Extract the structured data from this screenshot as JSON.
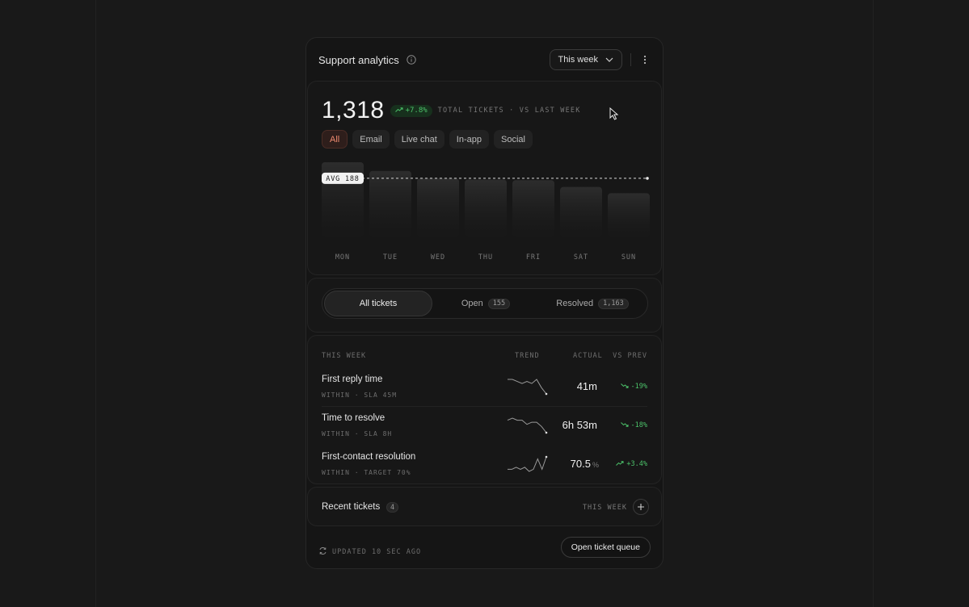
{
  "header": {
    "title": "Support analytics",
    "info_icon": "info-circle-icon",
    "range_select": {
      "value": "This week",
      "icon": "chevron-down-icon"
    },
    "more_icon": "more-vertical-icon"
  },
  "summary": {
    "total": "1,318",
    "delta": "+7.8%",
    "delta_icon": "trend-up-icon",
    "caption": "TOTAL TICKETS · VS LAST WEEK",
    "accent_color": "#ee8a70",
    "positive_color": "#4cc26a"
  },
  "channel_filters": [
    {
      "label": "All",
      "active": true
    },
    {
      "label": "Email",
      "active": false
    },
    {
      "label": "Live chat",
      "active": false
    },
    {
      "label": "In-app",
      "active": false
    },
    {
      "label": "Social",
      "active": false
    }
  ],
  "chart_data": {
    "type": "bar",
    "categories": [
      "MON",
      "TUE",
      "WED",
      "THU",
      "FRI",
      "SAT",
      "SUN"
    ],
    "values": [
      240,
      212,
      188,
      184,
      182,
      160,
      140
    ],
    "reference_line": {
      "label": "AVG 188",
      "value": 188
    },
    "ylim": [
      0,
      240
    ],
    "grid": false,
    "legend": "none"
  },
  "status_tabs": [
    {
      "label": "All tickets",
      "count": null,
      "active": true
    },
    {
      "label": "Open",
      "count": "155",
      "active": false
    },
    {
      "label": "Resolved",
      "count": "1,163",
      "active": false
    }
  ],
  "metrics": {
    "columns": {
      "name": "THIS WEEK",
      "trend": "TREND",
      "actual": "ACTUAL",
      "prev": "VS PREV"
    },
    "rows": [
      {
        "name": "First reply time",
        "sub": "WITHIN · SLA 45M",
        "actual": "41m",
        "unit": "",
        "prev": "-19%",
        "prev_icon": "trend-down-icon",
        "trend": [
          9,
          9,
          8,
          7,
          8,
          7,
          9,
          5,
          2
        ]
      },
      {
        "name": "Time to resolve",
        "sub": "WITHIN · SLA 8H",
        "actual": "6h 53m",
        "unit": "",
        "prev": "-18%",
        "prev_icon": "trend-down-icon",
        "trend": [
          8,
          9,
          8,
          8,
          6,
          7,
          7,
          5,
          2
        ]
      },
      {
        "name": "First-contact resolution",
        "sub": "WITHIN · TARGET 70%",
        "actual": "70.5",
        "unit": "%",
        "prev": "+3.4%",
        "prev_icon": "trend-up-icon",
        "trend": [
          3,
          3,
          4,
          3,
          4,
          2,
          3,
          8,
          3,
          9
        ]
      }
    ]
  },
  "recent": {
    "title": "Recent tickets",
    "count": "4",
    "range": "THIS WEEK",
    "add_icon": "plus-icon"
  },
  "footer": {
    "updated": "UPDATED 10 SEC AGO",
    "refresh_icon": "refresh-icon",
    "button": "Open ticket queue"
  }
}
